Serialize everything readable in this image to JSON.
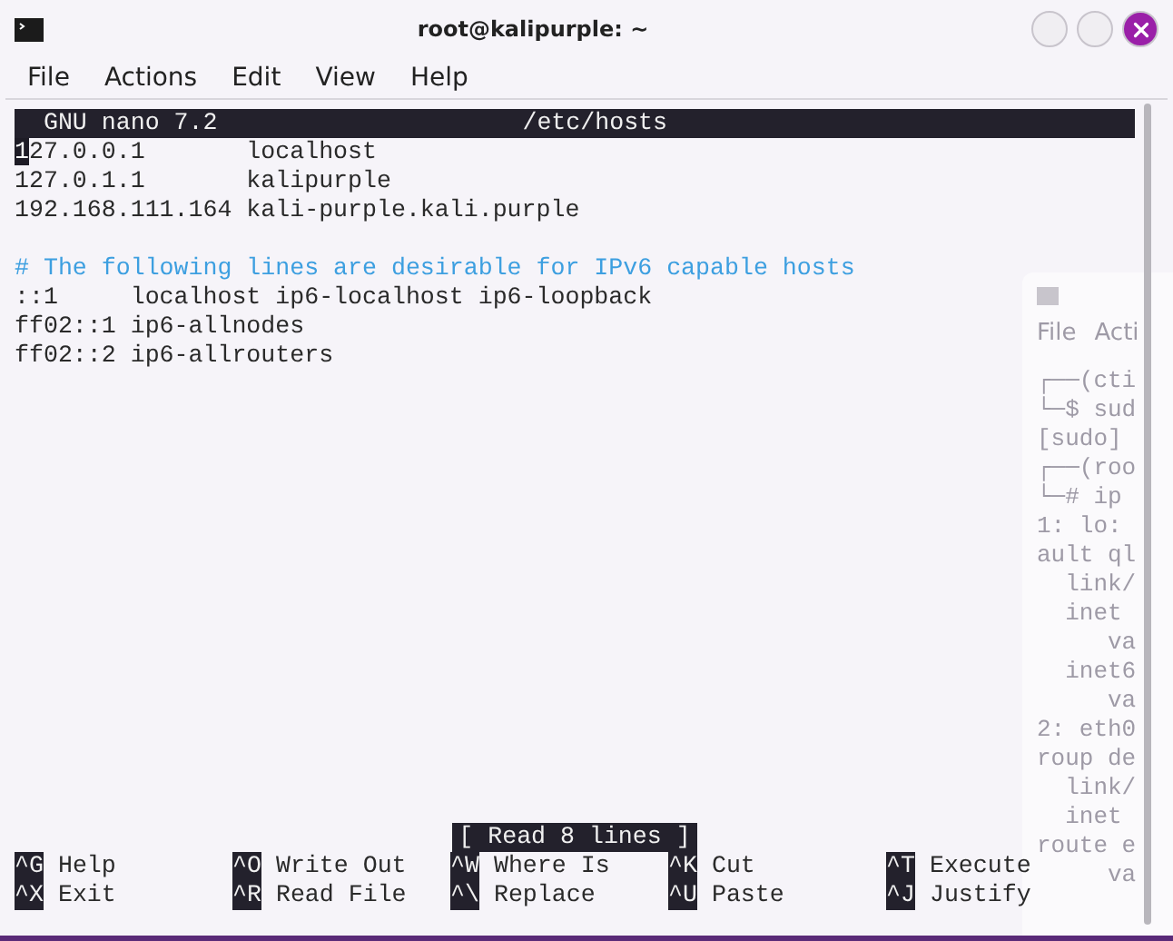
{
  "window": {
    "title": "root@kalipurple: ~"
  },
  "menu": [
    "File",
    "Actions",
    "Edit",
    "View",
    "Help"
  ],
  "nano": {
    "version": "GNU nano 7.2",
    "file": "/etc/hosts",
    "lines": [
      {
        "kind": "text",
        "text": "127.0.0.1       localhost",
        "cursor": true
      },
      {
        "kind": "text",
        "text": "127.0.1.1       kalipurple",
        "cursor": false
      },
      {
        "kind": "text",
        "text": "192.168.111.164 kali-purple.kali.purple",
        "cursor": false
      },
      {
        "kind": "blank"
      },
      {
        "kind": "comment",
        "text": "# The following lines are desirable for IPv6 capable hosts",
        "cursor": false
      },
      {
        "kind": "text",
        "text": "::1     localhost ip6-localhost ip6-loopback",
        "cursor": false
      },
      {
        "kind": "text",
        "text": "ff02::1 ip6-allnodes",
        "cursor": false
      },
      {
        "kind": "text",
        "text": "ff02::2 ip6-allrouters",
        "cursor": false
      }
    ],
    "status": "[ Read 8 lines ]",
    "shortcuts": [
      [
        {
          "key": "^G",
          "label": "Help"
        },
        {
          "key": "^X",
          "label": "Exit"
        }
      ],
      [
        {
          "key": "^O",
          "label": "Write Out"
        },
        {
          "key": "^R",
          "label": "Read File"
        }
      ],
      [
        {
          "key": "^W",
          "label": "Where Is"
        },
        {
          "key": "^\\",
          "label": "Replace"
        }
      ],
      [
        {
          "key": "^K",
          "label": "Cut"
        },
        {
          "key": "^U",
          "label": "Paste"
        }
      ],
      [
        {
          "key": "^T",
          "label": "Execute"
        },
        {
          "key": "^J",
          "label": "Justify"
        }
      ]
    ]
  },
  "background_window": {
    "menu": [
      "File",
      "Acti"
    ],
    "lines": [
      "┌──(cti",
      "└─$ sud",
      "[sudo]",
      "┌──(roo",
      "└─# ip",
      "1: lo:",
      "ault ql",
      "  link/",
      "  inet",
      "     va",
      "  inet6",
      "     va",
      "2: eth0",
      "roup de",
      "  link/",
      "  inet",
      "route e",
      "     va"
    ]
  }
}
